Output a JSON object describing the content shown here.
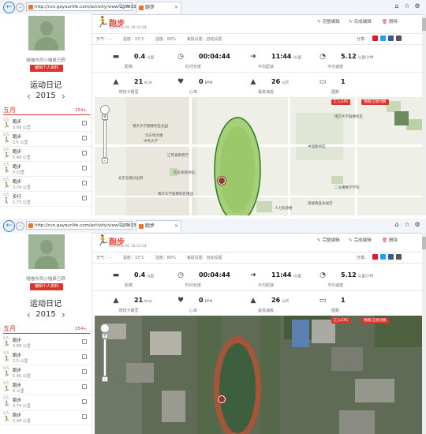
{
  "screens": [
    {
      "browser": {
        "url": "http://run.gayourlife.com/activity/view/239433",
        "tab_title": "跑步"
      },
      "sidebar": {
        "username": "喵喵东西小喵鼻已晒",
        "edit_label": "编辑个人资料",
        "diary_title": "运动日记",
        "year": "2015",
        "month": "五月",
        "month_count": "154+",
        "items": [
          {
            "date": "5/5",
            "title": "跑步",
            "value": "3.89 公里"
          },
          {
            "date": "5/5",
            "title": "跑步",
            "value": "2.5 公里"
          },
          {
            "date": "5/5",
            "title": "跑步",
            "value": "5.46 公里"
          },
          {
            "date": "5/5",
            "title": "跑步",
            "value": "0 公里"
          },
          {
            "date": "5/5",
            "title": "跑步",
            "value": "3.74 公里"
          },
          {
            "date": "5/5",
            "title": "步行",
            "value": "1.75 公里"
          }
        ]
      },
      "header": {
        "title": "跑步",
        "date": "2015-06-20 18:33:44",
        "edit_label": "完整编辑",
        "complete_label": "完成编辑",
        "delete_label": "删除",
        "weather": [
          "天气：- -",
          "温度：15°C",
          "湿度：80%",
          "海拔设置：自动设置"
        ],
        "share_label": "分享："
      },
      "stats": [
        {
          "icon": "shoe-icon",
          "value": "0.4",
          "unit": "公里",
          "label": "距离"
        },
        {
          "icon": "clock-icon",
          "value": "00:04:44",
          "unit": "",
          "label": "时间长度"
        },
        {
          "icon": "speed-icon",
          "value": "11:44",
          "unit": "/公里",
          "label": "平均配速"
        },
        {
          "icon": "gauge-icon",
          "value": "5.12",
          "unit": "公里/小时",
          "label": "平均速度"
        },
        {
          "icon": "flame-icon",
          "value": "21",
          "unit": "Kcal",
          "label": "燃烧卡路里"
        },
        {
          "icon": "heart-icon",
          "value": "0",
          "unit": "BPM",
          "label": "心率"
        },
        {
          "icon": "mountain-icon",
          "value": "26",
          "unit": "公尺",
          "label": "最高海拔"
        },
        {
          "icon": "lap-icon",
          "value": "1",
          "unit": "",
          "label": "圈数"
        }
      ],
      "map": {
        "style": "street",
        "btn_gps": "汇入GPS",
        "btn_map": "地图/卫星切换",
        "labels": [
          "南京大学鼓楼校区北园",
          "华东师大楼",
          "江苏省教育厅",
          "历史系图书馆",
          "南京大学鼓楼校区南园",
          "中国图书馆",
          "二号楼数学学院",
          "人力资源楼",
          "基督教圣永福堂",
          "南京大学鼓楼校区",
          "中央大学",
          "北京东路派出所"
        ]
      }
    },
    {
      "browser": {
        "url": "http://run.gayourlife.com/activity/view/239433",
        "tab_title": "跑步"
      },
      "sidebar": {
        "username": "喵喵东西小喵鼻已晒",
        "edit_label": "编辑个人资料",
        "diary_title": "运动日记",
        "year": "2015",
        "month": "五月",
        "month_count": "154+",
        "items": [
          {
            "date": "5/5",
            "title": "跑步",
            "value": "3.89 公里"
          },
          {
            "date": "5/5",
            "title": "跑步",
            "value": "2.5 公里"
          },
          {
            "date": "5/5",
            "title": "跑步",
            "value": "5.46 公里"
          },
          {
            "date": "5/5",
            "title": "跑步",
            "value": "0 公里"
          },
          {
            "date": "5/5",
            "title": "跑步",
            "value": "3.74 公里"
          },
          {
            "date": "5/5",
            "title": "跑步",
            "value": "2.48 公里"
          }
        ]
      },
      "header": {
        "title": "跑步",
        "date": "2015-06-20 18:33:44",
        "edit_label": "完整编辑",
        "complete_label": "完成编辑",
        "delete_label": "删除",
        "weather": [
          "天气：- -",
          "温度：15°C",
          "湿度：80%",
          "海拔设置：自动设置"
        ],
        "share_label": "分享："
      },
      "stats": [
        {
          "icon": "shoe-icon",
          "value": "0.4",
          "unit": "公里",
          "label": "距离"
        },
        {
          "icon": "clock-icon",
          "value": "00:04:44",
          "unit": "",
          "label": "时间长度"
        },
        {
          "icon": "speed-icon",
          "value": "11:44",
          "unit": "/公里",
          "label": "平均配速"
        },
        {
          "icon": "gauge-icon",
          "value": "5.12",
          "unit": "公里/小时",
          "label": "平均速度"
        },
        {
          "icon": "flame-icon",
          "value": "21",
          "unit": "Kcal",
          "label": "燃烧卡路里"
        },
        {
          "icon": "heart-icon",
          "value": "0",
          "unit": "BPM",
          "label": "心率"
        },
        {
          "icon": "mountain-icon",
          "value": "26",
          "unit": "公尺",
          "label": "最高海拔"
        },
        {
          "icon": "lap-icon",
          "value": "1",
          "unit": "",
          "label": "圈数"
        }
      ],
      "map": {
        "style": "satellite",
        "btn_gps": "汇入GPS",
        "btn_map": "地图/卫星切换",
        "labels": []
      }
    }
  ]
}
